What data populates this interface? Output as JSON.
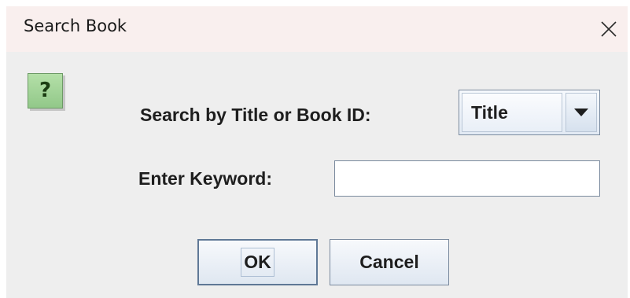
{
  "dialog": {
    "title": "Search Book",
    "close_icon": "close-icon",
    "message_icon": {
      "name": "question-icon",
      "glyph": "?"
    },
    "search_by": {
      "label": "Search by Title or Book ID:",
      "selected": "Title"
    },
    "keyword": {
      "label": "Enter Keyword:",
      "value": ""
    },
    "buttons": {
      "ok": "OK",
      "cancel": "Cancel"
    }
  },
  "colors": {
    "titlebar_bg": "#f9efee",
    "content_bg": "#eeeeee",
    "icon_green": "#92c889"
  }
}
